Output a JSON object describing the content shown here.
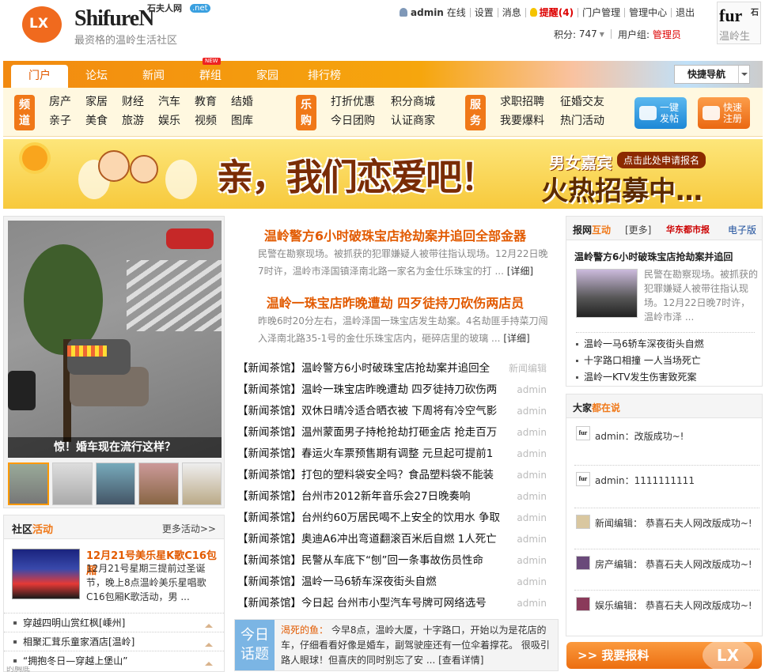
{
  "header": {
    "logo_short": "LX",
    "brand": "ShifureN",
    "brand_cn": "石夫人网",
    "brand_net": ".net",
    "slogan": "最资格的温岭生活社区",
    "user": "admin",
    "online": "在线",
    "links": [
      "设置",
      "消息"
    ],
    "remind": "提醒(4)",
    "admin_links": [
      "门户管理",
      "管理中心",
      "退出"
    ],
    "points_label": "积分:",
    "points": "747",
    "group_label": "用户组:",
    "group": "管理员",
    "avatar_top": "fur",
    "avatar_cn": "石",
    "avatar_bottom": "温岭生"
  },
  "nav": {
    "items": [
      "门户",
      "论坛",
      "新闻",
      "群组",
      "家园",
      "排行榜"
    ],
    "active": "门户",
    "new_badge": "NEW",
    "quick": "快捷导航"
  },
  "channels": {
    "pindao_label": "频道",
    "pindao": [
      "房产",
      "家居",
      "财经",
      "汽车",
      "教育",
      "结婚",
      "亲子",
      "美食",
      "旅游",
      "娱乐",
      "视频",
      "图库"
    ],
    "legou_label": "乐购",
    "legou": [
      "打折优惠",
      "积分商城",
      "今日团购",
      "认证商家"
    ],
    "fuwu_label": "服务",
    "fuwu": [
      "求职招聘",
      "征婚交友",
      "我要爆料",
      "热门活动"
    ],
    "post_btn": [
      "一键",
      "发帖"
    ],
    "reg_btn": [
      "快速",
      "注册"
    ]
  },
  "banner": {
    "slogan": "亲，我们恋爱吧！",
    "line1": "男女嘉宾",
    "apply": "点击此处申请报名",
    "line2": "火热招募中…"
  },
  "photo": {
    "caption": "惊！婚车现在流行这样？"
  },
  "community": {
    "title_a": "社区",
    "title_b": "活动",
    "more": "更多活动>>",
    "event_title": "12月21号美乐星K歌C16包厢",
    "event_desc": "12月21号星期三提前过圣诞节，晚上8点温岭美乐星唱歌C16包厢K歌活动，男 ...",
    "list": [
      "穿越四明山赏红枫[嵊州]",
      "相聚汇茸乐童家酒店[温岭]",
      "“拥抱冬日—穿越上堡山”"
    ]
  },
  "headlines": [
    {
      "title": "温岭警方6小时破珠宝店抢劫案并追回全部金器",
      "desc": "民警在勘察现场。被抓获的犯罪嫌疑人被带往指认现场。12月22日晚7时许，温岭市泽国镇泽南北路一家名为金仕乐珠宝的打 ...",
      "detail": "[详细]"
    },
    {
      "title": "温岭一珠宝店昨晚遭劫 四歹徒持刀砍伤两店员",
      "desc": "昨晚6时20分左右，温岭泽国一珠宝店发生劫案。4名劫匪手持菜刀闯入泽南北路35-1号的金仕乐珠宝店内，砸碎店里的玻璃 ...",
      "detail": "[详细]"
    }
  ],
  "news": [
    {
      "tag": "【新闻茶馆】",
      "title": "温岭警方6小时破珠宝店抢劫案并追回全",
      "author": "新闻编辑"
    },
    {
      "tag": "【新闻茶馆】",
      "title": "温岭一珠宝店昨晚遭劫 四歹徒持刀砍伤两",
      "author": "admin"
    },
    {
      "tag": "【新闻茶馆】",
      "title": "双休日晴冷适合晒衣被 下周将有冷空气影",
      "author": "admin"
    },
    {
      "tag": "【新闻茶馆】",
      "title": "温州蒙面男子持枪抢劫打砸金店 抢走百万",
      "author": "admin"
    },
    {
      "tag": "【新闻茶馆】",
      "title": "春运火车票预售期有调整 元旦起可提前1",
      "author": "admin"
    },
    {
      "tag": "【新闻茶馆】",
      "title": "打包的塑料袋安全吗？食品塑料袋不能装",
      "author": "admin"
    },
    {
      "tag": "【新闻茶馆】",
      "title": "台州市2012新年音乐会27日晚奏响",
      "author": "admin"
    },
    {
      "tag": "【新闻茶馆】",
      "title": "台州约60万居民喝不上安全的饮用水 争取",
      "author": "admin"
    },
    {
      "tag": "【新闻茶馆】",
      "title": "奥迪A6冲出弯道翻滚百米后自燃 1人死亡",
      "author": "admin"
    },
    {
      "tag": "【新闻茶馆】",
      "title": "民警从车底下“刨”回一条事故伤员性命",
      "author": "admin"
    },
    {
      "tag": "【新闻茶馆】",
      "title": "温岭一马6轿车深夜街头自燃",
      "author": "admin"
    },
    {
      "tag": "【新闻茶馆】",
      "title": "今日起 台州市小型汽车号牌可网络选号",
      "author": "admin"
    }
  ],
  "today": {
    "label": [
      "今日",
      "话题"
    ],
    "author": "渴死的鱼：",
    "text": "今早8点，温岭大厦，十字路口，开始以为是花店的车，仔细看看好像是婚车，副驾驶座还有一位伞着撑花。 很吸引路人眼球！但喜庆的同时别忘了安 ...",
    "detail": "[查看详情]"
  },
  "paper": {
    "title_a": "报网",
    "title_b": "互动",
    "more": "[更多]",
    "logo": "华东都市报",
    "epaper": "电子版",
    "headline": "温岭警方6小时破珠宝店抢劫案并追回",
    "desc": "民警在勘察现场。被抓获的犯罪嫌疑人被带往指认现场。12月22日晚7时许，温岭市泽 ...",
    "list": [
      "温岭一马6轿车深夜街头自燃",
      "十字路口相撞 一人当场死亡",
      "温岭一KTV发生伤害致死案"
    ]
  },
  "talk": {
    "title_a": "大家",
    "title_b": "都在说",
    "items": [
      {
        "avatar": "fur",
        "text": "admin：改版成功~!"
      },
      {
        "avatar": "fur",
        "text": "admin：1111111111"
      },
      {
        "avatar": "",
        "text": "新闻编辑： 恭喜石夫人网改版成功~!"
      },
      {
        "avatar": "",
        "text": "房产编辑： 恭喜石夫人网改版成功~!"
      },
      {
        "avatar": "",
        "text": "娱乐编辑： 恭喜石夫人网改版成功~!"
      }
    ]
  },
  "report": {
    "label": ">> 我要报料",
    "logo": "LX"
  },
  "footer": {
    "text": "的胸底"
  }
}
